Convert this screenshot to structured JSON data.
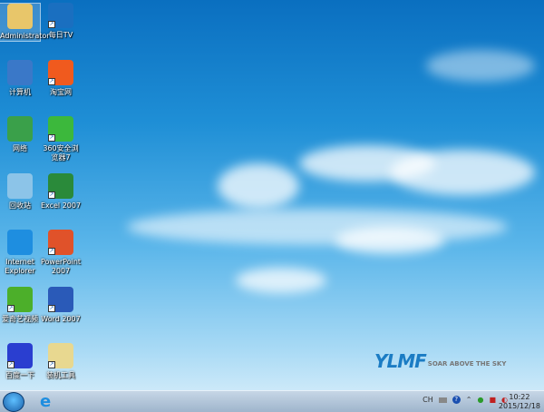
{
  "desktop": {
    "icons": [
      {
        "label": "Administrator",
        "icon": "user-folder-icon",
        "color": "#e8c66a"
      },
      {
        "label": "计算机",
        "icon": "computer-icon",
        "color": "#3a78c8"
      },
      {
        "label": "网络",
        "icon": "network-icon",
        "color": "#3aa04a"
      },
      {
        "label": "回收站",
        "icon": "recycle-bin-icon",
        "color": "#8cc4e8"
      },
      {
        "label": "Internet Explorer",
        "icon": "ie-icon",
        "color": "#1e8ee0"
      },
      {
        "label": "爱奇艺视频",
        "icon": "iqiyi-icon",
        "color": "#4caf2a"
      },
      {
        "label": "百度一下",
        "icon": "baidu-icon",
        "color": "#2a3ed0"
      },
      {
        "label": "每日TV",
        "icon": "tv-icon",
        "color": "#1a6fc0"
      },
      {
        "label": "淘宝网",
        "icon": "taobao-icon",
        "color": "#f05a1e"
      },
      {
        "label": "360安全浏览器7",
        "icon": "browser-360-icon",
        "color": "#3cb83c"
      },
      {
        "label": "Excel 2007",
        "icon": "excel-icon",
        "color": "#2a8a3a"
      },
      {
        "label": "PowerPoint 2007",
        "icon": "powerpoint-icon",
        "color": "#e0522a"
      },
      {
        "label": "Word 2007",
        "icon": "word-icon",
        "color": "#2a5ab8"
      },
      {
        "label": "装机工具",
        "icon": "folder-icon",
        "color": "#e8d890"
      }
    ]
  },
  "wallpaper": {
    "logo": "YLMF",
    "tagline": "SOAR ABOVE THE SKY"
  },
  "taskbar": {
    "tray_lang": "CH",
    "time": "10:22",
    "date": "2015/12/18"
  }
}
